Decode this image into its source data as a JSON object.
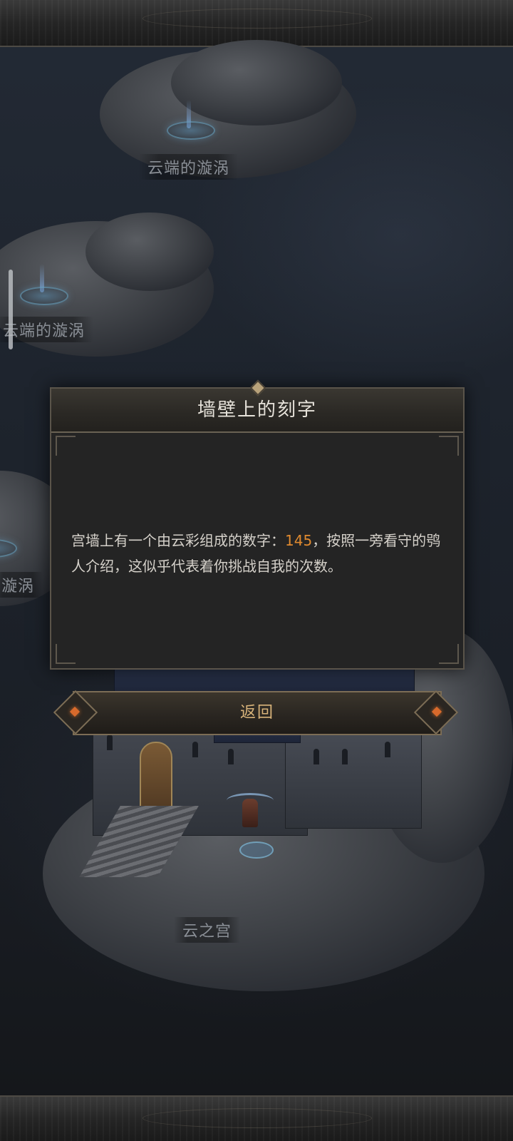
{
  "map": {
    "locations": [
      {
        "label": "云端的漩涡"
      },
      {
        "label": "云端的漩涡"
      },
      {
        "label": "漩涡"
      },
      {
        "label": "云之宫"
      }
    ]
  },
  "dialog": {
    "title": "墙壁上的刻字",
    "body_prefix": "宫墙上有一个由云彩组成的数字：",
    "highlight_number": "145",
    "body_suffix": "，按照一旁看守的鸮人介绍，这似乎代表着你挑战自我的次数。",
    "highlight_color": "#e08a2f"
  },
  "buttons": {
    "return_label": "返回"
  }
}
